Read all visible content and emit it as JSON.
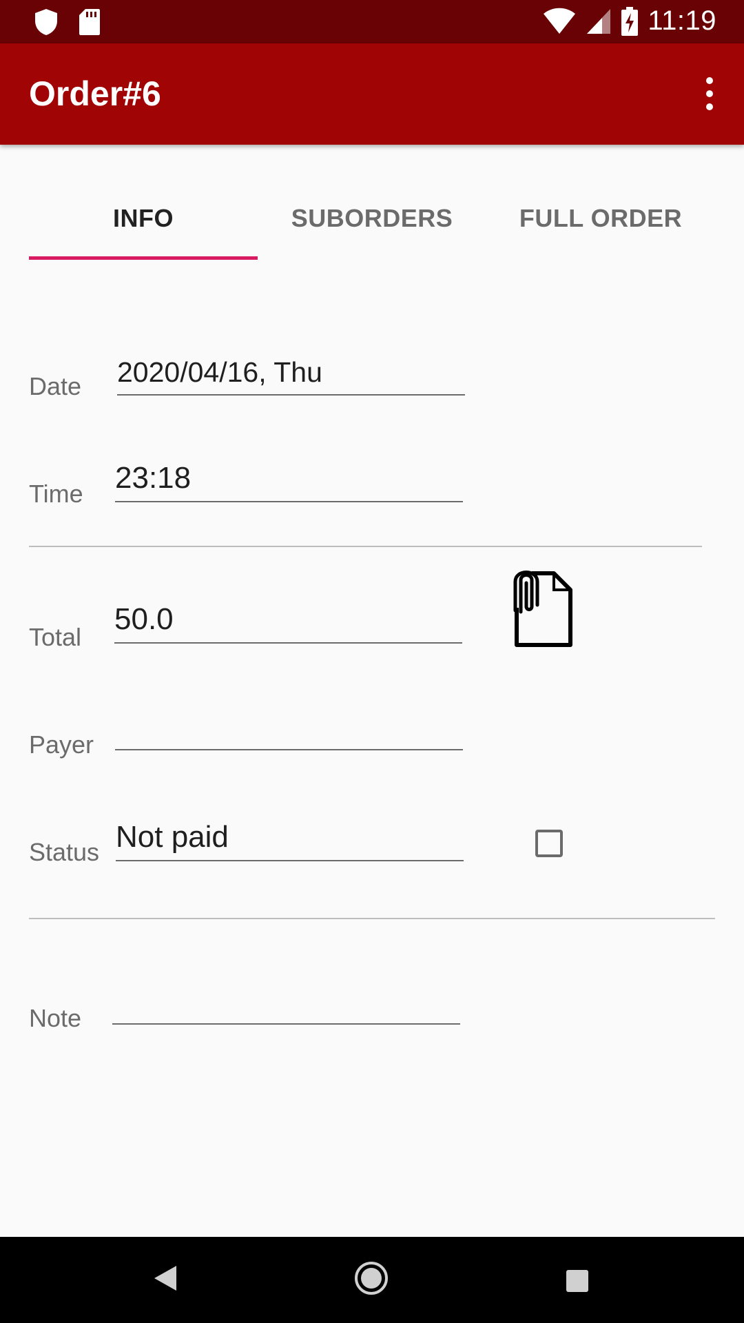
{
  "status_bar": {
    "time": "11:19",
    "left_icons": [
      "shield-icon",
      "sd-card-icon"
    ],
    "right_icons": [
      "wifi-icon",
      "signal-icon",
      "battery-charging-icon"
    ]
  },
  "app_bar": {
    "title": "Order#6",
    "menu_icon": "more-vert-icon"
  },
  "tabs": [
    {
      "label": "INFO",
      "active": true
    },
    {
      "label": "SUBORDERS",
      "active": false
    },
    {
      "label": "FULL ORDER",
      "active": false
    }
  ],
  "form": {
    "date": {
      "label": "Date",
      "value": "2020/04/16, Thu"
    },
    "time": {
      "label": "Time",
      "value": "23:18"
    },
    "total": {
      "label": "Total",
      "value": "50.0"
    },
    "payer": {
      "label": "Payer",
      "value": ""
    },
    "status": {
      "label": "Status",
      "value": "Not paid",
      "checked": false
    },
    "note": {
      "label": "Note",
      "value": ""
    }
  },
  "colors": {
    "status_bar": "#680204",
    "app_bar": "#a10404",
    "tab_indicator": "#d81b60"
  },
  "nav_bar": {
    "icons": [
      "back-icon",
      "home-icon",
      "recents-icon"
    ]
  }
}
